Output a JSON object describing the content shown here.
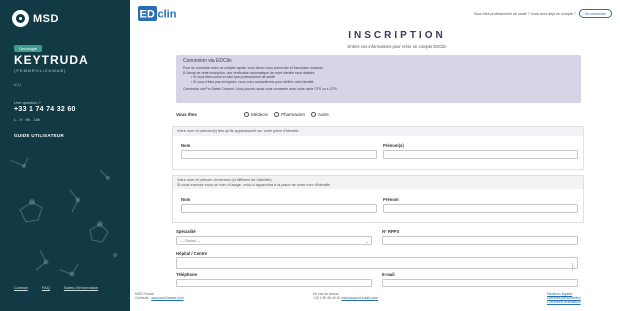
{
  "brand": {
    "msd": "MSD",
    "edclin": "EDclin"
  },
  "sidebar": {
    "tag": "Oncologie",
    "product": "KEYTRUDA",
    "product_sub": "(PEMBROLIZUMAB)",
    "small": "ICU",
    "label": "Une question ?",
    "phone": "+33 1 74 74 32 60",
    "hours": "L - V : 9h - 18h",
    "guide": "GUIDE UTILISATEUR",
    "footer_links": [
      "Contact",
      "FAQ",
      "Notes d'information"
    ]
  },
  "header": {
    "question": "Vous êtes professionnel de santé ? Vous avez déjà un compte ?",
    "connect_button": "Se connecter"
  },
  "page": {
    "title": "INSCRIPTION",
    "subtitle": "Entrez vos informations pour créer un compte EDClin"
  },
  "info": {
    "title": "Connexion via EDClin",
    "line1": "Pour se connecter avec un compte rapide, vous devez vous connecter à l'inscription suivante.",
    "line2": "À l'issue de cette inscription, une vérification automatique de votre identité sera réalisée.",
    "bullets": [
      "Si vous êtes connu en tant que professionnel de santé",
      "Si vous n'êtes pas enregistré, nous vous contacterons pour vérifier votre identité"
    ],
    "footer": "Connexion via Pro Santé Connect. Vous pouvez aussi vous connecter avec votre carte CPS ou e-CPS."
  },
  "roles": {
    "label": "Vous êtes",
    "options": [
      "Médecin",
      "Pharmacien",
      "Autre"
    ]
  },
  "section1": {
    "header": "Votre nom et prénom(s) tels qu'ils apparaissent sur votre pièce d'identité",
    "nom_label": "Nom",
    "prenom_label": "Prénom(s)"
  },
  "section2": {
    "header": "Votre nom et prénom d'exercice (si différent de l'identité)",
    "header2": "Si vous exercez sous un nom d'usage, celui-ci apparaîtra à la place de votre nom d'identité.",
    "nom_label": "Nom",
    "prenom_label": "Prénom"
  },
  "form": {
    "specialite_label": "Spécialité",
    "specialite_value": "— Choisir —",
    "rpps_label": "N° RPPS",
    "hopital_label": "Hôpital / Centre",
    "telephone_label": "Téléphone",
    "email_label": "E-mail"
  },
  "footer": {
    "c1_line1": "MSD France",
    "c1_line2": "Contacts :",
    "c1_link": "www.msd-france.com",
    "c2_line1": "En cas de besoin",
    "c2_line2": "+33 1 80 46 40 40",
    "c2_link": "www.support-edclin.com",
    "c3_links": [
      "Mentions légales",
      "Données personnelles",
      "Conditions d'utilisation"
    ]
  },
  "colors": {
    "sidebar": "#123a45",
    "accent": "#3e9a8c",
    "info_bg": "#d8d4e8",
    "title": "#3a3a55",
    "link": "#2a6fb0"
  }
}
